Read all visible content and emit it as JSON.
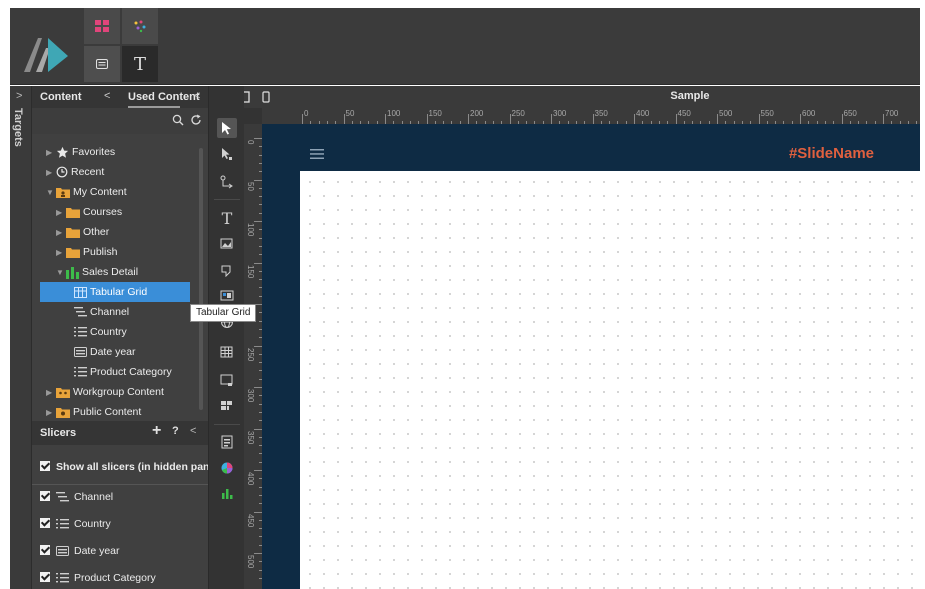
{
  "ribbon": {
    "tiles": [
      {
        "name": "grid",
        "icon": "grid-icon"
      },
      {
        "name": "dots",
        "icon": "dots-icon"
      },
      {
        "name": "slide",
        "icon": "slide-icon"
      },
      {
        "name": "text",
        "label": "T"
      }
    ]
  },
  "targets": {
    "label": "Targets",
    "chevron": ">"
  },
  "content_panel": {
    "tab_content": "Content",
    "back": "<",
    "tab_used_content": "Used Content",
    "back2": "<",
    "tree": [
      {
        "label": "Favorites",
        "icon": "star-icon",
        "level": 0,
        "expanded": false
      },
      {
        "label": "Recent",
        "icon": "clock-icon",
        "level": 0,
        "expanded": false
      },
      {
        "label": "My Content",
        "icon": "folder-icon",
        "level": 0,
        "expanded": true
      },
      {
        "label": "Courses",
        "icon": "folder-icon",
        "level": 1,
        "expanded": false
      },
      {
        "label": "Other",
        "icon": "folder-icon",
        "level": 1,
        "expanded": false
      },
      {
        "label": "Publish",
        "icon": "folder-icon",
        "level": 1,
        "expanded": false
      },
      {
        "label": "Sales Detail",
        "icon": "cube-icon",
        "level": 1,
        "expanded": true
      },
      {
        "label": "Tabular Grid",
        "icon": "grid-icon",
        "level": 2,
        "selected": true
      },
      {
        "label": "Channel",
        "icon": "list-icon",
        "level": 2
      },
      {
        "label": "Country",
        "icon": "list-icon",
        "level": 2
      },
      {
        "label": "Date year",
        "icon": "calendar-icon",
        "level": 2
      },
      {
        "label": "Product Category",
        "icon": "list-icon",
        "level": 2
      },
      {
        "label": "Workgroup Content",
        "icon": "folder-icon",
        "level": 0,
        "expanded": false
      },
      {
        "label": "Public Content",
        "icon": "folder-icon",
        "level": 0,
        "expanded": false
      }
    ]
  },
  "slicers": {
    "title": "Slicers",
    "add": "+",
    "help": "?",
    "collapse": "<",
    "show_all": "Show all slicers (in hidden panel)",
    "items": [
      {
        "label": "Channel",
        "icon": "list-icon",
        "checked": true
      },
      {
        "label": "Country",
        "icon": "list-icon",
        "checked": true
      },
      {
        "label": "Date year",
        "icon": "calendar-icon",
        "checked": true
      },
      {
        "label": "Product Category",
        "icon": "list-icon",
        "checked": true
      }
    ]
  },
  "canvas": {
    "title": "Sample",
    "slide_name": "#SlideName",
    "hruler_labels": [
      "0",
      "50",
      "100",
      "150",
      "200",
      "250",
      "300",
      "350",
      "400",
      "450",
      "500",
      "550",
      "600",
      "650",
      "700"
    ],
    "vruler_labels": [
      "0",
      "50",
      "100",
      "150",
      "200",
      "250",
      "300",
      "350",
      "400",
      "450",
      "500"
    ]
  },
  "tooltip": {
    "text": "Tabular Grid"
  },
  "colors": {
    "accent": "#3a8ed8",
    "slide_name": "#e0603f",
    "canvas_bg": "#0e2b44",
    "folder": "#e8a33a",
    "cube": "#3dbb4a"
  }
}
